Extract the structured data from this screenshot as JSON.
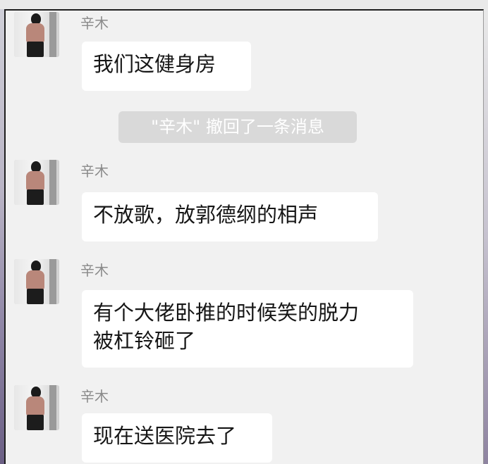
{
  "contact": {
    "name": "辛木"
  },
  "system_notice": "\"辛木\" 撤回了一条消息",
  "messages": [
    {
      "sender": "辛木",
      "lines": [
        "我们这健身房"
      ]
    },
    {
      "sender": "辛木",
      "lines": [
        "不放歌，放郭德纲的相声"
      ]
    },
    {
      "sender": "辛木",
      "lines": [
        "有个大佬卧推的时候笑的脱力",
        "被杠铃砸了"
      ]
    },
    {
      "sender": "辛木",
      "lines": [
        "现在送医院去了"
      ]
    }
  ],
  "icons": {
    "avatar": "person-photo-avatar"
  }
}
